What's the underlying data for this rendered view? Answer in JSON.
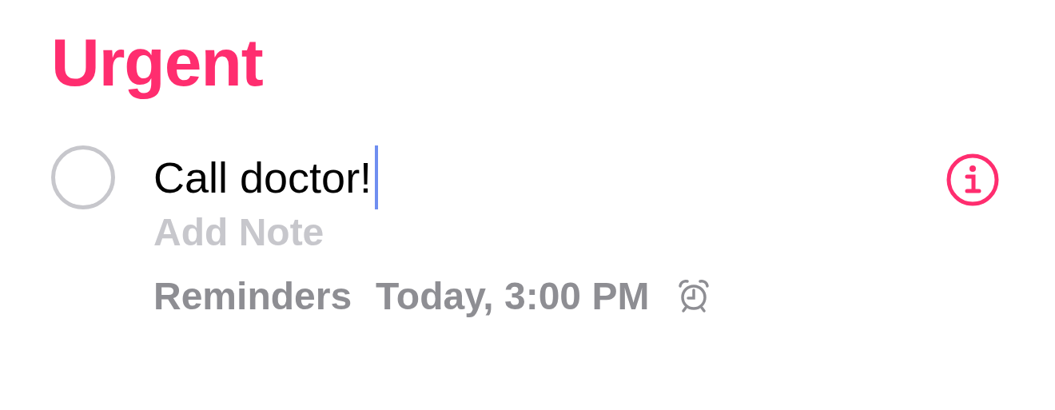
{
  "list": {
    "title": "Urgent",
    "color": "#ff2d6f"
  },
  "reminder": {
    "title": "Call doctor!",
    "editing": true,
    "completed": false,
    "note_placeholder": "Add Note",
    "list_name": "Reminders",
    "due": "Today, 3:00 PM",
    "alarm": true
  }
}
